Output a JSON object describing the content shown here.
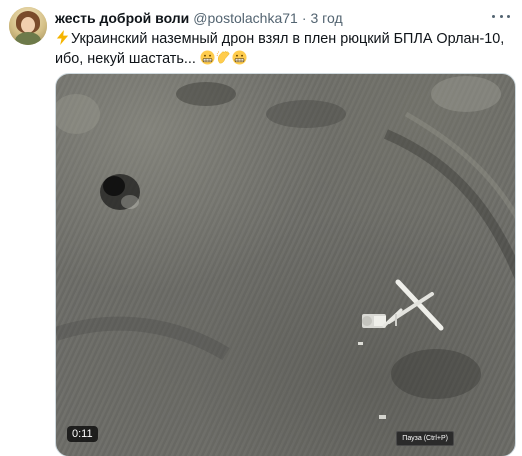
{
  "tweet": {
    "display_name": "жесть доброй воли",
    "handle": "@postolachka71",
    "separator": "·",
    "time": "3 год",
    "text_line1": "Украинский наземный дрон взял в плен рюцкий БПЛА Орлан-10,",
    "text_line2": "ибо, некуй шастать...",
    "emojis_leading": [
      "lightning-icon"
    ],
    "emojis_trailing": [
      "grimace-face-icon",
      "clapping-hands-icon",
      "grimace-face-icon"
    ]
  },
  "media": {
    "timestamp": "0:11",
    "pause_tooltip": "Пауза (Ctrl+P)"
  },
  "colors": {
    "text_primary": "#0f1419",
    "text_secondary": "#536471",
    "border": "#cfd9de"
  }
}
